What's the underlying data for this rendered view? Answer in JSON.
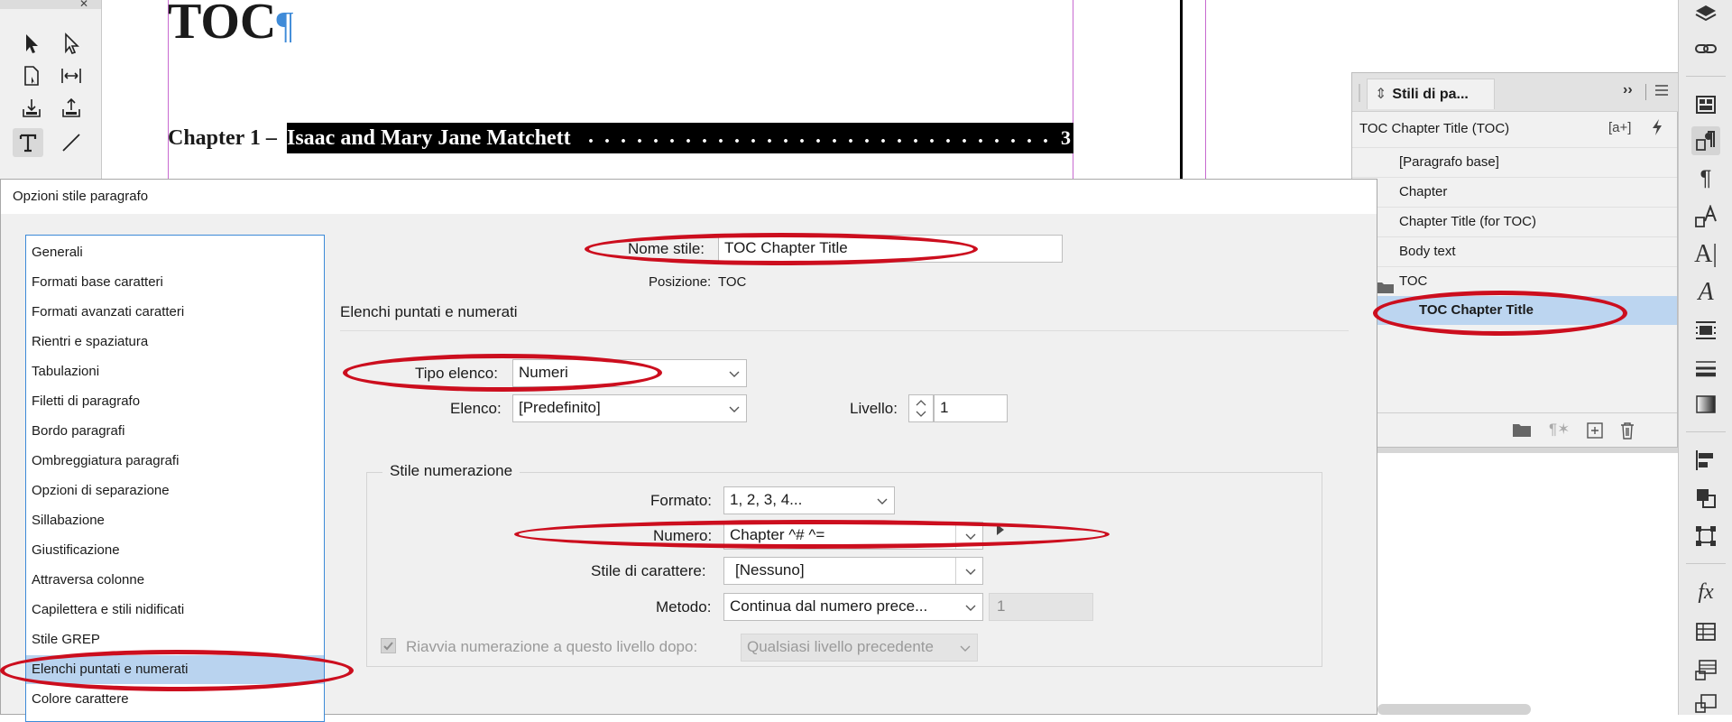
{
  "document": {
    "heading": "TOC",
    "toc_line_prefix": "Chapter 1 –",
    "toc_line_text": "Isaac and Mary Jane Matchett",
    "toc_line_dots": ". . . . . . . . . . . . . . . . . . . . . . . . . . . . . . . . . . . . . . . . . . . . . . .",
    "toc_line_page": "3"
  },
  "styles_panel": {
    "tab_label": "Stili di pa...",
    "current_style": "TOC Chapter Title (TOC)",
    "items": [
      {
        "label": "[Paragrafo base]"
      },
      {
        "label": "Chapter"
      },
      {
        "label": "Chapter Title (for TOC)"
      },
      {
        "label": "Body text"
      },
      {
        "label": "TOC"
      },
      {
        "label": "TOC Chapter Title"
      }
    ],
    "new_style_glyph": "[a+]"
  },
  "dialog": {
    "title": "Opzioni stile paragrafo",
    "categories": [
      "Generali",
      "Formati base caratteri",
      "Formati avanzati caratteri",
      "Rientri e spaziatura",
      "Tabulazioni",
      "Filetti di paragrafo",
      "Bordo paragrafi",
      "Ombreggiatura paragrafi",
      "Opzioni di separazione",
      "Sillabazione",
      "Giustificazione",
      "Attraversa colonne",
      "Capilettera e stili nidificati",
      "Stile GREP",
      "Elenchi puntati e numerati",
      "Colore carattere"
    ],
    "style_name_label": "Nome stile:",
    "style_name_value": "TOC Chapter Title",
    "position_label": "Posizione:",
    "position_value": "TOC",
    "section_title": "Elenchi puntati e numerati",
    "list_type_label": "Tipo elenco:",
    "list_type_value": "Numeri",
    "list_label": "Elenco:",
    "list_value": "[Predefinito]",
    "level_label": "Livello:",
    "level_value": "1",
    "numbering_group_title": "Stile numerazione",
    "format_label": "Formato:",
    "format_value": "1, 2, 3, 4...",
    "number_label": "Numero:",
    "number_value": "Chapter ^# ^=",
    "char_style_label": "Stile di carattere:",
    "char_style_value": "[Nessuno]",
    "method_label": "Metodo:",
    "method_value": "Continua dal numero prece...",
    "method_start_value": "1",
    "restart_label": "Riavvia numerazione a questo livello dopo:",
    "restart_value": "Qualsiasi livello precedente"
  },
  "icons": {
    "rail": [
      "layers-icon",
      "links-icon",
      "pages-icon",
      "paragraph-styles-icon",
      "paragraph-icon",
      "character-styles-icon",
      "character-icon",
      "glyph-icon",
      "text-wrap-icon",
      "stroke-icon",
      "gradient-icon",
      "align-icon",
      "pathfinder-icon",
      "transform-icon",
      "effects-icon",
      "table-icon",
      "table-styles-icon",
      "cell-styles-icon"
    ]
  },
  "colors": {
    "annotation_red": "#cc0e1e",
    "selection_blue": "#b9d3ef",
    "frame_magenta": "#c86ad0"
  }
}
